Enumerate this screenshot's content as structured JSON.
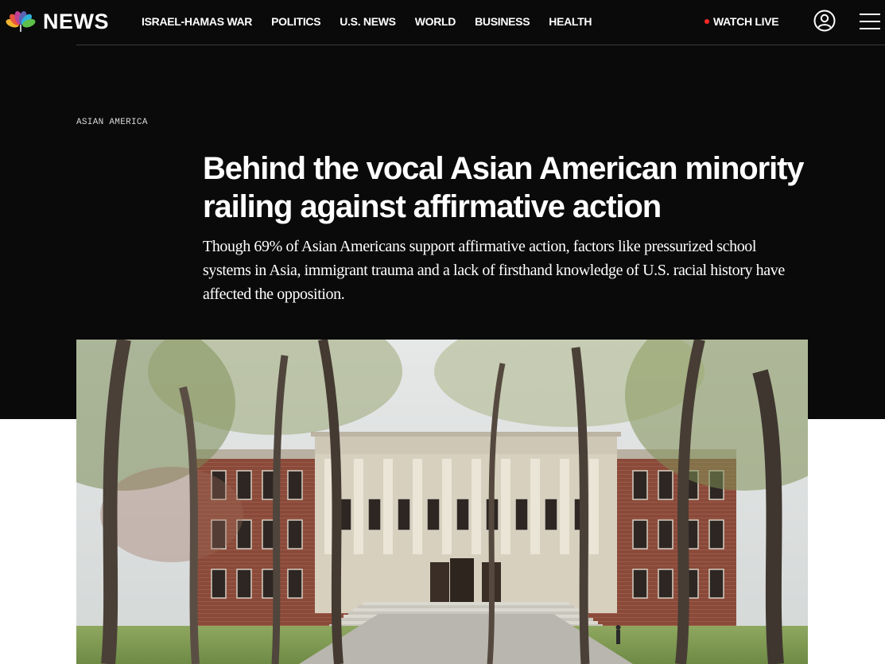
{
  "brand": {
    "logo_text": "NEWS",
    "peacock_colors": [
      "#f0b32f",
      "#e8563d",
      "#c03f92",
      "#5a63b4",
      "#2eb0d9",
      "#5ec04a"
    ]
  },
  "nav": {
    "items": [
      {
        "label": "ISRAEL-HAMAS WAR"
      },
      {
        "label": "POLITICS"
      },
      {
        "label": "U.S. NEWS"
      },
      {
        "label": "WORLD"
      },
      {
        "label": "BUSINESS"
      },
      {
        "label": "HEALTH"
      }
    ],
    "watch_live": "WATCH LIVE",
    "live_color": "#ff2a2a",
    "account_icon": "user-circle-icon",
    "menu_icon": "hamburger-menu-icon"
  },
  "article": {
    "eyebrow": "ASIAN AMERICA",
    "headline": "Behind the vocal Asian American minority railing against affirmative action",
    "dek": "Though 69% of Asian Americans support affirmative action, factors like pressurized school systems in Asia, immigrant trauma and a lack of firsthand knowledge of U.S. racial history have affected the opposition."
  },
  "theme": {
    "background": "#0a0a0a",
    "text": "#ffffff",
    "page": "#ffffff"
  }
}
